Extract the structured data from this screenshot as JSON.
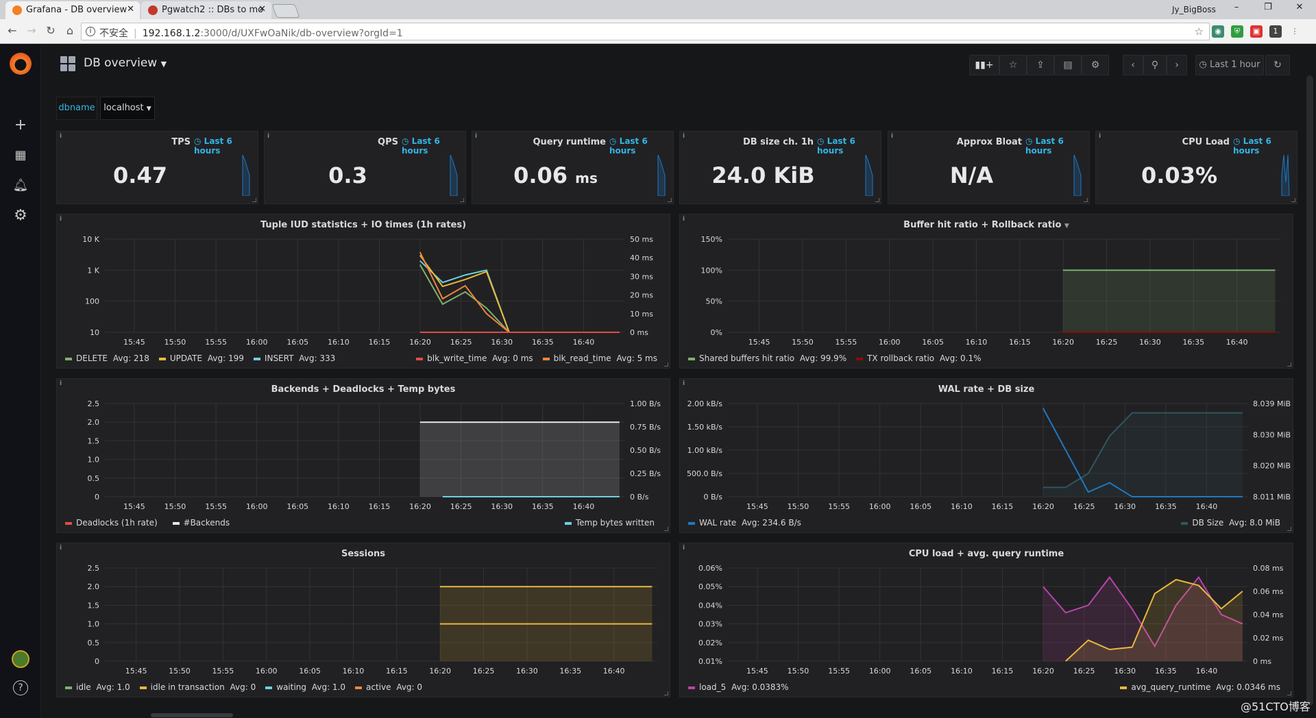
{
  "browser": {
    "tabs": [
      {
        "title": "Grafana - DB overview",
        "active": true
      },
      {
        "title": "Pgwatch2 :: DBs to mo",
        "active": false
      }
    ],
    "window_user": "Jy_BigBoss",
    "window_controls": [
      "–",
      "❐",
      "✕"
    ],
    "security_label": "不安全",
    "url_host": "192.168.1.2",
    "url_path": ":3000/d/UXFwOaNik/db-overview?orgId=1",
    "extension_badge": "1"
  },
  "sidebar": {
    "items": [
      "plus-icon",
      "dashboards-icon",
      "alerts-bell-icon",
      "gear-icon"
    ],
    "help": "?"
  },
  "dashboard": {
    "title": "DB overview",
    "time_range": "Last 1 hour",
    "variable_label": "dbname",
    "variable_value": "localhost"
  },
  "stats": [
    {
      "title": "TPS",
      "info": "Last 6 hours",
      "value": "0.47",
      "unit": ""
    },
    {
      "title": "QPS",
      "info": "Last 6 hours",
      "value": "0.3",
      "unit": ""
    },
    {
      "title": "Query runtime",
      "info": "Last 6 hours",
      "value": "0.06",
      "unit": "ms"
    },
    {
      "title": "DB size ch. 1h",
      "info": "Last 6 hours",
      "value": "24.0 KiB",
      "unit": ""
    },
    {
      "title": "Approx Bloat",
      "info": "Last 6 hours",
      "value": "N/A",
      "unit": ""
    },
    {
      "title": "CPU Load",
      "info": "Last 6 hours",
      "value": "0.03%",
      "unit": ""
    }
  ],
  "x_ticks": [
    "15:45",
    "15:50",
    "15:55",
    "16:00",
    "16:05",
    "16:10",
    "16:15",
    "16:20",
    "16:25",
    "16:30",
    "16:35",
    "16:40"
  ],
  "colors": {
    "green": "#7eb26d",
    "yellow": "#eab839",
    "cyan": "#6ed0e0",
    "red": "#e24d42",
    "orange": "#ef843c",
    "white": "#e8e8e8",
    "blue": "#1f78c1",
    "teal": "#447ebc",
    "darkteal": "#2f575e",
    "pink": "#ba43a9",
    "darkred": "#890f02"
  },
  "graphs": [
    {
      "title": "Tuple IUD statistics + IO times (1h rates)",
      "y_left": [
        "10 K",
        "1 K",
        "100",
        "10"
      ],
      "y_right": [
        "50 ms",
        "40 ms",
        "30 ms",
        "20 ms",
        "10 ms",
        "0 ms"
      ],
      "legend_left": [
        {
          "name": "DELETE",
          "stat": "Avg: 218",
          "color": "green"
        },
        {
          "name": "UPDATE",
          "stat": "Avg: 199",
          "color": "yellow"
        },
        {
          "name": "INSERT",
          "stat": "Avg: 333",
          "color": "cyan"
        }
      ],
      "legend_right": [
        {
          "name": "blk_write_time",
          "stat": "Avg: 0 ms",
          "color": "red"
        },
        {
          "name": "blk_read_time",
          "stat": "Avg: 5 ms",
          "color": "orange"
        }
      ],
      "series": [
        {
          "color": "cyan",
          "log": true,
          "x": [
            16.33,
            16.5,
            16.67,
            16.83,
            17,
            17.83
          ],
          "y": [
            2000,
            400,
            700,
            1000,
            10,
            10
          ]
        },
        {
          "color": "green",
          "log": true,
          "x": [
            16.33,
            16.5,
            16.67,
            16.83,
            17,
            17.83
          ],
          "y": [
            1500,
            80,
            200,
            60,
            10,
            10
          ]
        },
        {
          "color": "yellow",
          "log": true,
          "x": [
            16.33,
            16.5,
            16.67,
            16.83,
            17,
            17.83
          ],
          "y": [
            3000,
            300,
            500,
            900,
            10,
            10
          ]
        },
        {
          "color": "orange",
          "log": false,
          "right": true,
          "x": [
            16.33,
            16.5,
            16.67,
            16.83,
            17,
            17.83
          ],
          "y": [
            43,
            18,
            25,
            10,
            0,
            0
          ]
        },
        {
          "color": "red",
          "log": false,
          "right": true,
          "x": [
            16.33,
            17,
            17.83
          ],
          "y": [
            0,
            0,
            0
          ]
        }
      ],
      "chart_data": {
        "type": "line",
        "xlabel": "",
        "ylabel": ""
      }
    },
    {
      "title": "Buffer hit ratio + Rollback ratio",
      "y_left": [
        "150%",
        "100%",
        "50%",
        "0%"
      ],
      "y_right": [],
      "legend_left": [
        {
          "name": "Shared buffers hit ratio",
          "stat": "Avg: 99.9%",
          "color": "green"
        },
        {
          "name": "TX rollback ratio",
          "stat": "Avg: 0.1%",
          "color": "darkred"
        }
      ],
      "legend_right": [],
      "series": [
        {
          "color": "green",
          "fill": true,
          "x": [
            16.33,
            17.83
          ],
          "y": [
            100,
            100
          ],
          "ymax": 150
        },
        {
          "color": "darkred",
          "x": [
            16.33,
            17.83
          ],
          "y": [
            0.1,
            0.1
          ],
          "ymax": 150
        }
      ],
      "dropdown": true
    },
    {
      "title": "Backends + Deadlocks + Temp bytes",
      "y_left": [
        "2.5",
        "2.0",
        "1.5",
        "1.0",
        "0.5",
        "0"
      ],
      "y_right": [
        "1.00 B/s",
        "0.75 B/s",
        "0.50 B/s",
        "0.25 B/s",
        "0 B/s"
      ],
      "legend_left": [
        {
          "name": "Deadlocks (1h rate)",
          "stat": "",
          "color": "red"
        },
        {
          "name": "#Backends",
          "stat": "",
          "color": "white"
        }
      ],
      "legend_right": [
        {
          "name": "Temp bytes written",
          "stat": "",
          "color": "cyan"
        }
      ],
      "series": [
        {
          "color": "white",
          "fill": true,
          "x": [
            16.33,
            17.83
          ],
          "y": [
            2,
            2
          ],
          "ymax": 2.5
        },
        {
          "color": "cyan",
          "x": [
            16.5,
            17.83
          ],
          "y": [
            0,
            0
          ],
          "ymax": 2.5
        }
      ]
    },
    {
      "title": "WAL rate + DB size",
      "y_left": [
        "2.00 kB/s",
        "1.50 kB/s",
        "1.00 kB/s",
        "500.0 B/s",
        "0 B/s"
      ],
      "y_right": [
        "8.039 MiB",
        "8.030 MiB",
        "8.020 MiB",
        "8.011 MiB"
      ],
      "legend_left": [
        {
          "name": "WAL rate",
          "stat": "Avg: 234.6 B/s",
          "color": "blue"
        }
      ],
      "legend_right": [
        {
          "name": "DB Size",
          "stat": "Avg: 8.0 MiB",
          "color": "darkteal"
        }
      ],
      "series": [
        {
          "color": "darkteal",
          "fill": true,
          "x": [
            16.33,
            16.5,
            16.67,
            16.83,
            17,
            17.83
          ],
          "y": [
            0.2,
            0.2,
            0.5,
            1.3,
            1.8,
            1.8
          ],
          "ymax": 2.0
        },
        {
          "color": "blue",
          "x": [
            16.33,
            16.67,
            16.83,
            17,
            17.17,
            17.83
          ],
          "y": [
            1.9,
            0.1,
            0.3,
            0,
            0,
            0
          ],
          "ymax": 2.0
        }
      ]
    },
    {
      "title": "Sessions",
      "y_left": [
        "2.5",
        "2.0",
        "1.5",
        "1.0",
        "0.5",
        "0"
      ],
      "y_right": [],
      "legend_left": [
        {
          "name": "idle",
          "stat": "Avg: 1.0",
          "color": "green"
        },
        {
          "name": "idle in transaction",
          "stat": "Avg: 0",
          "color": "yellow"
        },
        {
          "name": "waiting",
          "stat": "Avg: 1.0",
          "color": "cyan"
        },
        {
          "name": "active",
          "stat": "Avg: 0",
          "color": "orange"
        }
      ],
      "legend_right": [],
      "series": [
        {
          "color": "yellow",
          "fill": true,
          "x": [
            16.33,
            17.83
          ],
          "y": [
            2,
            2
          ],
          "ymax": 2.5
        },
        {
          "color": "yellow",
          "x": [
            16.33,
            17.83
          ],
          "y": [
            1,
            1
          ],
          "ymax": 2.5
        }
      ]
    },
    {
      "title": "CPU load + avg. query runtime",
      "y_left": [
        "0.06%",
        "0.05%",
        "0.04%",
        "0.03%",
        "0.02%",
        "0.01%"
      ],
      "y_right": [
        "0.08 ms",
        "0.06 ms",
        "0.04 ms",
        "0.02 ms",
        "0 ms"
      ],
      "legend_left": [
        {
          "name": "load_5",
          "stat": "Avg: 0.0383%",
          "color": "pink"
        }
      ],
      "legend_right": [
        {
          "name": "avg_query_runtime",
          "stat": "Avg: 0.0346 ms",
          "color": "yellow"
        }
      ],
      "series": [
        {
          "color": "pink",
          "fill": true,
          "x": [
            16.33,
            16.5,
            16.67,
            16.83,
            17,
            17.17,
            17.33,
            17.5,
            17.67,
            17.83
          ],
          "y": [
            0.05,
            0.036,
            0.04,
            0.055,
            0.038,
            0.018,
            0.04,
            0.055,
            0.035,
            0.03
          ],
          "ymin": 0.01,
          "ymax": 0.06
        },
        {
          "color": "yellow",
          "fill": true,
          "x": [
            16.5,
            16.67,
            16.83,
            17,
            17.17,
            17.33,
            17.5,
            17.67,
            17.83
          ],
          "y": [
            0,
            0.018,
            0.01,
            0.012,
            0.058,
            0.07,
            0.065,
            0.045,
            0.06
          ],
          "ymin": 0,
          "ymax": 0.08,
          "right": true
        }
      ]
    }
  ],
  "watermark": "@51CTO博客"
}
